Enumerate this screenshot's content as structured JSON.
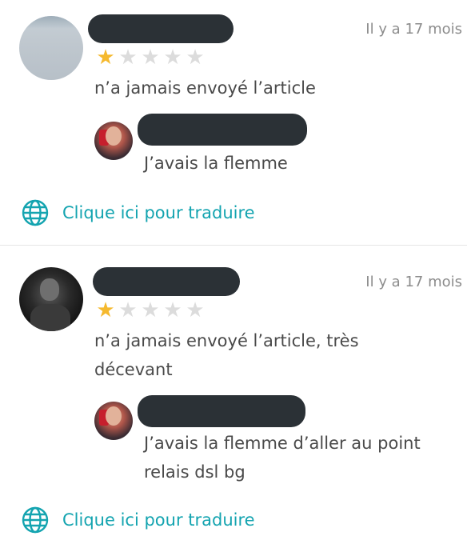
{
  "reviews": [
    {
      "date": "Il y a 17 mois",
      "rating": 1,
      "max_rating": 5,
      "comment_lines": [
        "n’a jamais envoyé l’article"
      ],
      "reply_lines": [
        "J’avais la flemme"
      ],
      "translate_label": "Clique ici pour traduire"
    },
    {
      "date": "Il y a 17 mois",
      "rating": 1,
      "max_rating": 5,
      "comment_lines": [
        "n’a jamais envoyé l’article, très",
        "décevant"
      ],
      "reply_lines": [
        "J’avais la flemme d’aller au point",
        "relais dsl bg"
      ],
      "translate_label": "Clique ici pour traduire"
    }
  ],
  "icons": {
    "star": "star-icon",
    "translate": "globe-icon"
  },
  "colors": {
    "star_filled": "#f5b92e",
    "star_empty": "#dcdcdc",
    "accent": "#14a4b0",
    "text": "#4a4a4a",
    "muted": "#8c8c8c"
  }
}
